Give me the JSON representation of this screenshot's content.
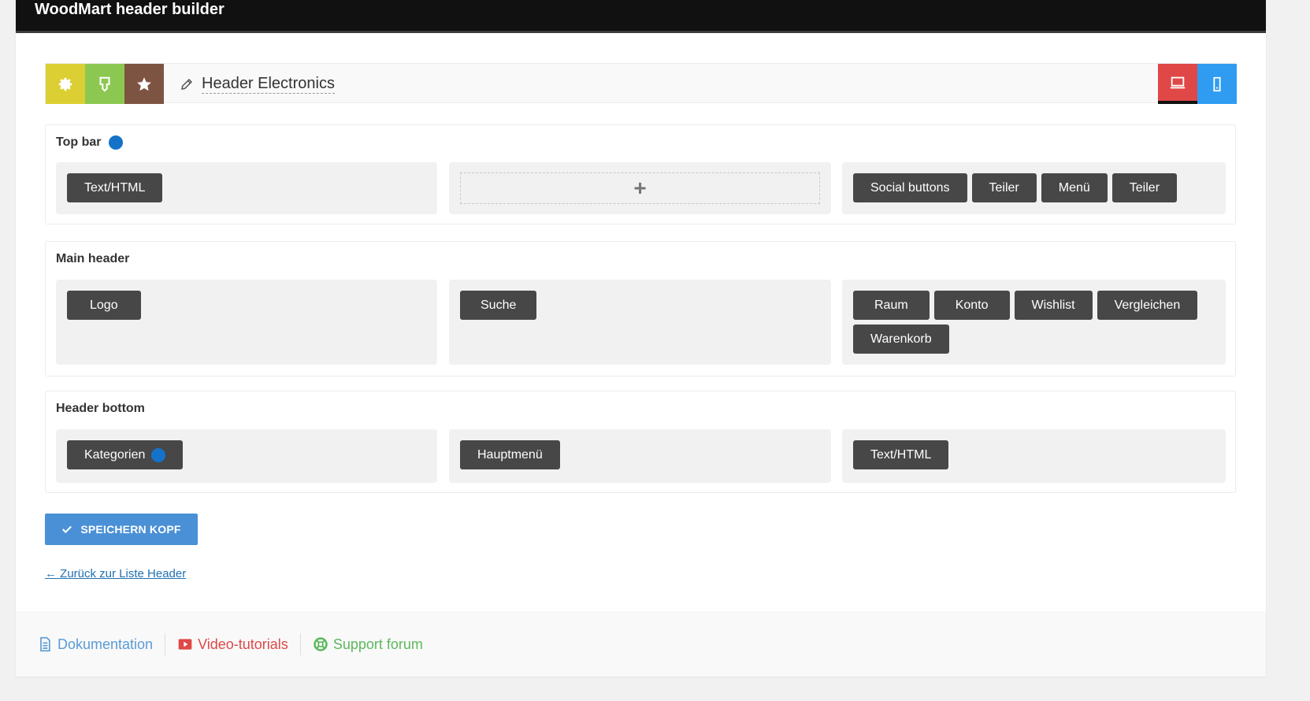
{
  "app": {
    "title": "WoodMart header builder"
  },
  "toolbar": {
    "buttons": [
      {
        "icon": "gear-icon",
        "color": "#dccf33"
      },
      {
        "icon": "import-icon",
        "color": "#8cc851"
      },
      {
        "icon": "star-icon",
        "color": "#7d5442"
      }
    ],
    "header_name": "Header Electronics",
    "devices": [
      {
        "icon": "desktop-icon",
        "color": "#e04747"
      },
      {
        "icon": "mobile-icon",
        "color": "#2f9cf2"
      }
    ]
  },
  "rows": {
    "top_bar": {
      "title": "Top bar",
      "left": [
        "Text/HTML"
      ],
      "center_add": "+",
      "right": [
        "Social buttons",
        "Teiler",
        "Menü",
        "Teiler"
      ]
    },
    "main_header": {
      "title": "Main header",
      "left": [
        "Logo"
      ],
      "center": [
        "Suche"
      ],
      "right": [
        "Raum",
        "Konto",
        "Wishlist",
        "Vergleichen",
        "Warenkorb"
      ]
    },
    "header_bottom": {
      "title": "Header bottom",
      "left": [
        "Kategorien"
      ],
      "center": [
        "Hauptmenü"
      ],
      "right": [
        "Text/HTML"
      ]
    }
  },
  "actions": {
    "save_label": "SPEICHERN KOPF",
    "back_label": "← Zurück zur Liste Header"
  },
  "footer": {
    "links": [
      {
        "label": "Dokumentation",
        "color": "#5b9bd5",
        "icon": "document-icon"
      },
      {
        "label": "Video-tutorials",
        "color": "#e04747",
        "icon": "video-icon"
      },
      {
        "label": "Support forum",
        "color": "#5cb85c",
        "icon": "lifebuoy-icon"
      }
    ]
  },
  "colors": {
    "accent": "#4a90d6",
    "element_bg": "#474747",
    "indicator": "#1473c8"
  }
}
